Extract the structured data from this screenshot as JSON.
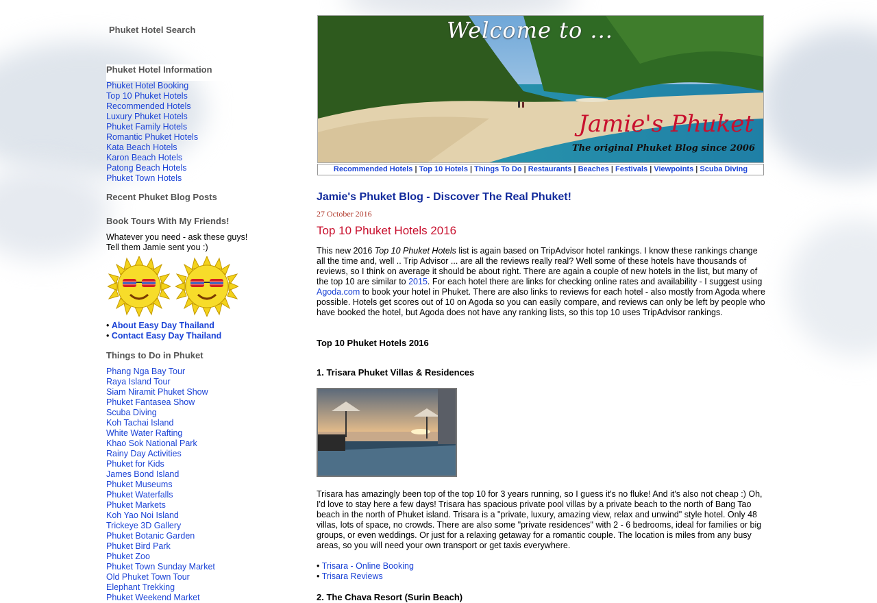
{
  "sidebar": {
    "hotel_search_title": "Phuket Hotel Search",
    "hotel_info_title": "Phuket Hotel Information",
    "hotel_links": [
      "Phuket Hotel Booking",
      "Top 10 Phuket Hotels",
      "Recommended Hotels",
      "Luxury Phuket Hotels",
      "Phuket Family Hotels",
      "Romantic Phuket Hotels",
      "Kata Beach Hotels",
      "Karon Beach Hotels",
      "Patong Beach Hotels",
      "Phuket Town Hotels"
    ],
    "recent_posts_title": "Recent Phuket Blog Posts",
    "tours_title": "Book Tours With My Friends!",
    "tours_text_1": "Whatever you need - ask these guys!",
    "tours_text_2": "Tell them Jamie sent you :)",
    "tours_links": [
      "About Easy Day Thailand",
      "Contact Easy Day Thailand"
    ],
    "things_title": "Things to Do in Phuket",
    "things_links": [
      "Phang Nga Bay Tour",
      "Raya Island Tour",
      "Siam Niramit Phuket Show",
      "Phuket Fantasea Show",
      "Scuba Diving",
      "Koh Tachai Island",
      "White Water Rafting",
      "Khao Sok National Park",
      "Rainy Day Activities",
      "Phuket for Kids",
      "James Bond Island",
      "Phuket Museums",
      "Phuket Waterfalls",
      "Phuket Markets",
      "Koh Yao Noi Island",
      "Trickeye 3D Gallery",
      "Phuket Botanic Garden",
      "Phuket Bird Park",
      "Phuket Zoo",
      "Phuket Town Sunday Market",
      "Old Phuket Town Tour",
      "Elephant Trekking",
      "Phuket Weekend Market"
    ]
  },
  "banner": {
    "welcome": "Welcome to ...",
    "name": "Jamie's Phuket",
    "tagline": "The original Phuket Blog since 2006"
  },
  "topnav": [
    "Recommended Hotels",
    "Top 10 Hotels",
    "Things To Do",
    "Restaurants",
    "Beaches",
    "Festivals",
    "Viewpoints",
    "Scuba Diving"
  ],
  "post": {
    "blog_title": "Jamie's Phuket Blog - Discover The Real Phuket!",
    "date": "27 October 2016",
    "title": "Top 10 Phuket Hotels 2016",
    "intro_a": "This new 2016 ",
    "intro_b": "Top 10 Phuket Hotels",
    "intro_c": " list is again based on TripAdvisor hotel rankings. I know these rankings change all the time and, well .. Trip Advisor ... are all the reviews really real? Well some of these hotels have thousands of reviews, so I think on average it should be about right. There are again a couple of new hotels in the list, but many of the top 10 are similar to ",
    "intro_link_2015": "2015",
    "intro_d": ". For each hotel there are links for checking online rates and availability - I suggest using ",
    "intro_link_agoda": "Agoda.com",
    "intro_e": " to book your hotel in Phuket. There are also links to reviews for each hotel - also mostly from Agoda where possible. Hotels get scores out of 10 on Agoda so you can easily compare, and reviews can only be left by people who have booked the hotel, but Agoda does not have any ranking lists, so this top 10 uses TripAdvisor rankings.",
    "section_title": "Top 10 Phuket Hotels 2016",
    "hotel1_title": "1. Trisara Phuket Villas & Residences",
    "hotel1_text": "Trisara has amazingly been top of the top 10 for 3 years running, so I guess it's no fluke! And it's also not cheap :) Oh, I'd love to stay here a few days! Trisara has spacious private pool villas by a private beach to the north of Bang Tao beach in the north of Phuket island. Trisara is a \"private, luxury, amazing view, relax and unwind\" style hotel. Only 48 villas, lots of space, no crowds. There are also some \"private residences\" with 2 - 6 bedrooms, ideal for families or big groups, or even weddings. Or just for a relaxing getaway for a romantic couple. The location is miles from any busy areas, so you will need your own transport or get taxis everywhere.",
    "hotel1_links": [
      "Trisara - Online Booking",
      "Trisara Reviews"
    ],
    "hotel2_title": "2. The Chava Resort (Surin Beach)"
  }
}
